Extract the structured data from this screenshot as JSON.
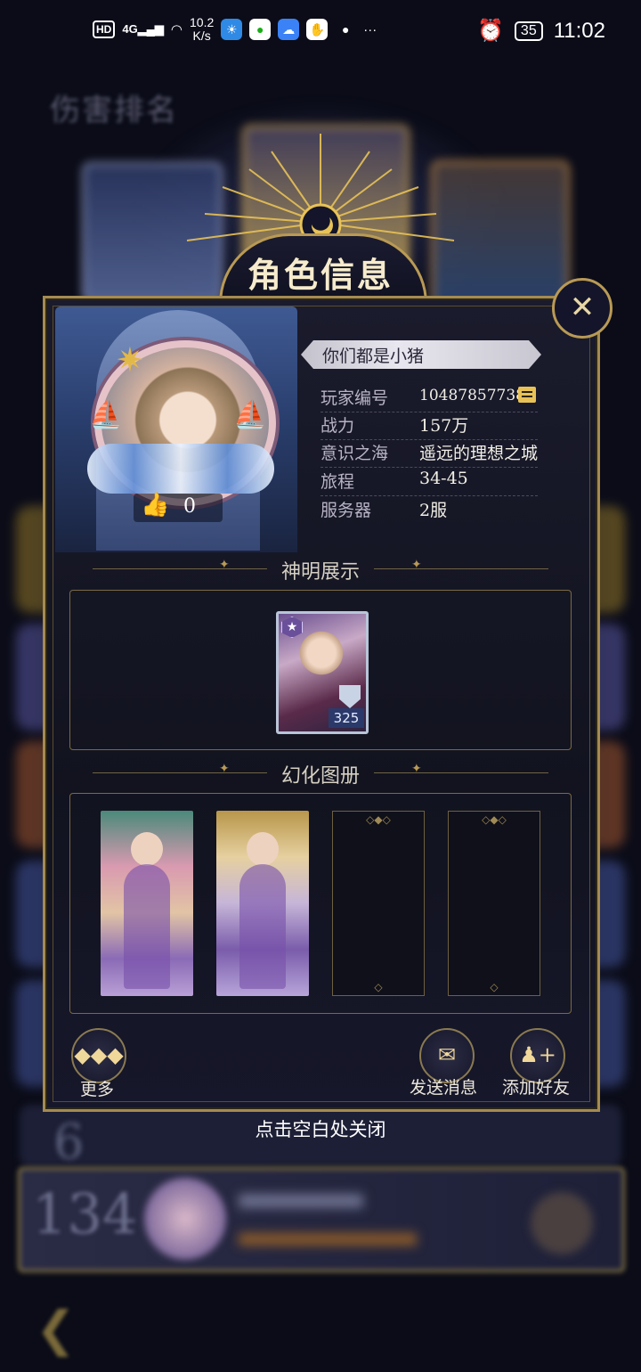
{
  "status_bar": {
    "hd": "HD",
    "signal": "4G",
    "speed_value": "10.2",
    "speed_unit": "K/s",
    "more": "···",
    "battery": "35",
    "time": "11:02"
  },
  "background": {
    "header_title": "伤害排名",
    "rank_row": "6",
    "my_rank": "134"
  },
  "dialog": {
    "title": "角色信息",
    "close_icon": "✕",
    "player_name": "你们都是小猪",
    "likes": "0",
    "info": [
      {
        "label": "玩家编号",
        "value": "10487857738"
      },
      {
        "label": "战力",
        "value": "157万"
      },
      {
        "label": "意识之海",
        "value": "遥远的理想之城"
      },
      {
        "label": "旅程",
        "value": "34-45"
      },
      {
        "label": "服务器",
        "value": "2服"
      }
    ],
    "god_section": {
      "title": "神明展示",
      "card_level": "325"
    },
    "album_section": {
      "title": "幻化图册"
    },
    "buttons": {
      "more": "更多",
      "send_message": "发送消息",
      "add_friend": "添加好友"
    }
  },
  "close_hint": "点击空白处关闭",
  "colors": {
    "gold": "#b99a55",
    "panel": "#14152a",
    "accent_yellow": "#e8c257"
  }
}
